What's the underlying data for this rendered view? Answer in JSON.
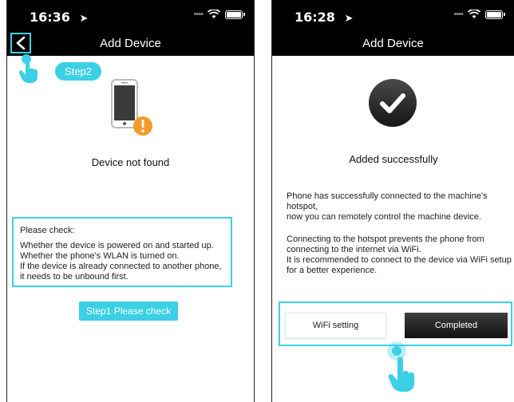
{
  "left_screen": {
    "status": {
      "time": "16:36"
    },
    "nav": {
      "title": "Add Device"
    },
    "step2_label": "Step2",
    "message": "Device not found",
    "check_box": {
      "heading": "Please check:",
      "lines": [
        "Whether the device is powered on and started up.",
        "Whether the phone's WLAN is turned on.",
        "If the device is already connected to another phone, it needs to be unbound first."
      ]
    },
    "step1_label": "Step1 Please check"
  },
  "right_screen": {
    "status": {
      "time": "16:28"
    },
    "nav": {
      "title": "Add Device"
    },
    "message": "Added successfully",
    "paragraph1": [
      "Phone has successfully connected to the machine's hotspot,",
      "now you can remotely control the machine device."
    ],
    "paragraph2": [
      "Connecting to the hotspot prevents the phone from connecting to the internet via WiFi.",
      "It is recommended to connect to the device via WiFi setup for a better experience."
    ],
    "buttons": {
      "wifi": "WiFi setting",
      "completed": "Completed"
    }
  },
  "colors": {
    "accent": "#3bd0e6",
    "warning": "#f39a2b",
    "dark": "#000000"
  },
  "icons": [
    "location-arrow-icon",
    "wifi-icon",
    "battery-icon",
    "back-chevron-icon",
    "phone-warning-icon",
    "checkmark-icon",
    "hand-pointer-icon"
  ]
}
